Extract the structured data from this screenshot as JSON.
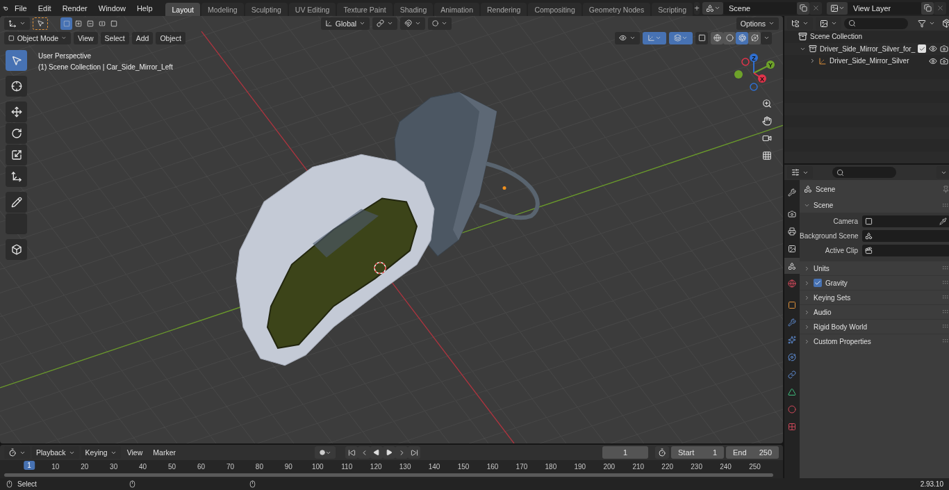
{
  "menu": [
    "File",
    "Edit",
    "Render",
    "Window",
    "Help"
  ],
  "workspaces": [
    {
      "label": "Layout",
      "selected": true
    },
    {
      "label": "Modeling",
      "selected": false
    },
    {
      "label": "Sculpting",
      "selected": false
    },
    {
      "label": "UV Editing",
      "selected": false
    },
    {
      "label": "Texture Paint",
      "selected": false
    },
    {
      "label": "Shading",
      "selected": false
    },
    {
      "label": "Animation",
      "selected": false
    },
    {
      "label": "Rendering",
      "selected": false
    },
    {
      "label": "Compositing",
      "selected": false
    },
    {
      "label": "Geometry Nodes",
      "selected": false
    },
    {
      "label": "Scripting",
      "selected": false
    }
  ],
  "add_workspace": "+",
  "scene": "Scene",
  "view_layer": "View Layer",
  "tool_header": {
    "select_modes": [
      {
        "kind": "new",
        "selected": true
      },
      {
        "kind": "extend",
        "selected": false
      },
      {
        "kind": "subtract",
        "selected": false
      },
      {
        "kind": "invert",
        "selected": false
      },
      {
        "kind": "intersect",
        "selected": false
      }
    ],
    "orientation": "Global",
    "options": "Options"
  },
  "viewport_header": {
    "mode": "Object Mode",
    "menus": [
      "View",
      "Select",
      "Add",
      "Object"
    ],
    "toggles": [
      {
        "kind": "gizmos",
        "on": true
      },
      {
        "kind": "overlays",
        "on": true
      },
      {
        "kind": "xray",
        "on": false
      }
    ],
    "shading": [
      {
        "kind": "wireframe",
        "selected": false
      },
      {
        "kind": "solid",
        "selected": false
      },
      {
        "kind": "material",
        "selected": true
      },
      {
        "kind": "rendered",
        "selected": false
      }
    ]
  },
  "viewport_info": [
    "User Perspective",
    "(1) Scene Collection | Car_Side_Mirror_Left"
  ],
  "tools": [
    {
      "kind": "select",
      "selected": true
    },
    {
      "kind": "cursor",
      "selected": false
    },
    {
      "kind": "move",
      "selected": false
    },
    {
      "kind": "rotate",
      "selected": false
    },
    {
      "kind": "scale",
      "selected": false
    },
    {
      "kind": "transform",
      "selected": false
    },
    {
      "kind": "annotate",
      "selected": false
    },
    {
      "kind": "measure",
      "selected": false
    },
    {
      "kind": "add-cube",
      "selected": false
    }
  ],
  "axes": [
    {
      "label": "Z",
      "color": "#2f6fd1"
    },
    {
      "label": "Y",
      "color": "#6ea22a"
    },
    {
      "label": "X",
      "color": "#e0334a"
    }
  ],
  "outliner": {
    "root": "Scene Collection",
    "children": [
      {
        "label": "Driver_Side_Mirror_Silver_for_",
        "kind": "collection",
        "expanded": true,
        "checked": true,
        "children": [
          {
            "label": "Driver_Side_Mirror_Silver",
            "kind": "empty",
            "expanded": false
          }
        ]
      }
    ]
  },
  "properties": {
    "tabs": [
      {
        "kind": "tool",
        "selected": false
      },
      {
        "kind": "render",
        "selected": false
      },
      {
        "kind": "output",
        "selected": false
      },
      {
        "kind": "view-layer",
        "selected": false
      },
      {
        "kind": "scene",
        "selected": true
      },
      {
        "kind": "world",
        "selected": false
      },
      {
        "kind": "object",
        "selected": false
      },
      {
        "kind": "modifiers",
        "selected": false
      },
      {
        "kind": "particles",
        "selected": false
      },
      {
        "kind": "physics",
        "selected": false
      },
      {
        "kind": "constraints",
        "selected": false
      },
      {
        "kind": "data",
        "selected": false
      },
      {
        "kind": "material",
        "selected": false
      },
      {
        "kind": "texture",
        "selected": false
      }
    ],
    "context": "Scene",
    "panel": {
      "title": "Scene",
      "expanded": true,
      "fields": [
        {
          "label": "Camera",
          "kind": "camera"
        },
        {
          "label": "Background Scene",
          "kind": "scene"
        },
        {
          "label": "Active Clip",
          "kind": "clip"
        }
      ]
    },
    "subpanels": [
      {
        "label": "Units",
        "kind": "plain",
        "expanded": false
      },
      {
        "label": "Gravity",
        "kind": "toggle",
        "checked": true,
        "expanded": false
      },
      {
        "label": "Keying Sets",
        "kind": "plain",
        "expanded": false
      },
      {
        "label": "Audio",
        "kind": "plain",
        "expanded": false
      },
      {
        "label": "Rigid Body World",
        "kind": "plain",
        "expanded": false
      },
      {
        "label": "Custom Properties",
        "kind": "plain",
        "expanded": false
      }
    ]
  },
  "timeline": {
    "menus": [
      "Playback",
      "Keying",
      "View",
      "Marker"
    ],
    "current_frame": "1",
    "start_label": "Start",
    "start": "1",
    "end_label": "End",
    "end": "250",
    "playhead": "1",
    "ticks": [
      "10",
      "20",
      "30",
      "40",
      "50",
      "60",
      "70",
      "80",
      "90",
      "100",
      "110",
      "120",
      "130",
      "140",
      "150",
      "160",
      "170",
      "180",
      "190",
      "200",
      "210",
      "220",
      "230",
      "240",
      "250"
    ]
  },
  "status": {
    "action": "Select",
    "version": "2.93.10"
  }
}
